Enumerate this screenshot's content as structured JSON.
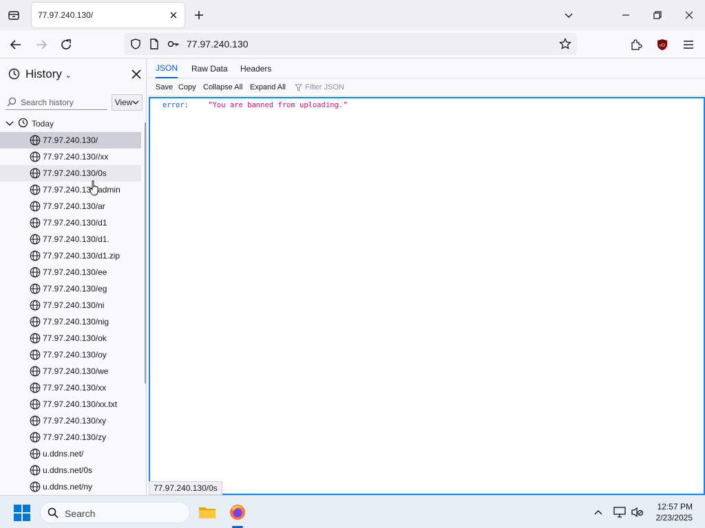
{
  "tab": {
    "title": "77.97.240.130/"
  },
  "navbar": {
    "url": "77.97.240.130"
  },
  "sidebar": {
    "title": "History",
    "search_placeholder": "Search history",
    "view_label": "View",
    "group_label": "Today",
    "items": [
      {
        "label": "77.97.240.130/",
        "state": "selected"
      },
      {
        "label": "77.97.240.130//xx",
        "state": ""
      },
      {
        "label": "77.97.240.130/0s",
        "state": "hover"
      },
      {
        "label": "77.97.240.130/admin",
        "state": ""
      },
      {
        "label": "77.97.240.130/ar",
        "state": ""
      },
      {
        "label": "77.97.240.130/d1",
        "state": ""
      },
      {
        "label": "77.97.240.130/d1.",
        "state": ""
      },
      {
        "label": "77.97.240.130/d1.zip",
        "state": ""
      },
      {
        "label": "77.97.240.130/ee",
        "state": ""
      },
      {
        "label": "77.97.240.130/eg",
        "state": ""
      },
      {
        "label": "77.97.240.130/ni",
        "state": ""
      },
      {
        "label": "77.97.240.130/nig",
        "state": ""
      },
      {
        "label": "77.97.240.130/ok",
        "state": ""
      },
      {
        "label": "77.97.240.130/oy",
        "state": ""
      },
      {
        "label": "77.97.240.130/we",
        "state": ""
      },
      {
        "label": "77.97.240.130/xx",
        "state": ""
      },
      {
        "label": "77.97.240.130/xx.txt",
        "state": ""
      },
      {
        "label": "77.97.240.130/xy",
        "state": ""
      },
      {
        "label": "77.97.240.130/zy",
        "state": ""
      },
      {
        "label": "u.ddns.net/",
        "state": ""
      },
      {
        "label": "u.ddns.net/0s",
        "state": ""
      },
      {
        "label": "u.ddns.net/ny",
        "state": ""
      }
    ]
  },
  "viewer": {
    "tabs": {
      "json": "JSON",
      "raw": "Raw Data",
      "headers": "Headers"
    },
    "toolbar": {
      "save": "Save",
      "copy": "Copy",
      "collapse": "Collapse All",
      "expand": "Expand All",
      "filter": "Filter JSON"
    },
    "json": {
      "key": "error:",
      "value": "\"You are banned from uploading.\""
    }
  },
  "status_tip": "77.97.240.130/0s",
  "taskbar": {
    "search": "Search",
    "time": "12:57 PM",
    "date": "2/23/2025"
  },
  "colors": {
    "accent": "#0060df",
    "focus_border": "#0a84ff",
    "json_key": "#0060df",
    "json_string": "#d7137d"
  }
}
